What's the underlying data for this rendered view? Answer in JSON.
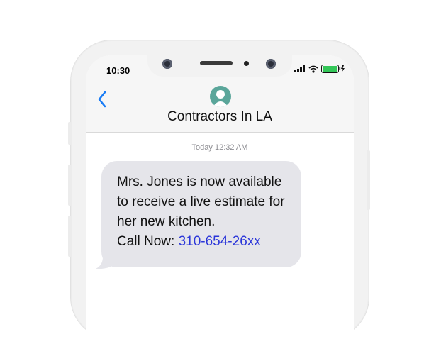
{
  "status_bar": {
    "time": "10:30"
  },
  "conversation": {
    "contact_name": "Contractors In LA",
    "timestamp": "Today 12:32 AM"
  },
  "message": {
    "lines": [
      "Mrs. Jones is now available",
      "to receive a live estimate for",
      "her new kitchen."
    ],
    "call_prefix": "Call Now: ",
    "phone_number": "310-654-26xx"
  },
  "colors": {
    "accent": "#1a7cf5",
    "bubble": "#e5e5ea",
    "link": "#2b36d9",
    "avatar": "#5aa69a",
    "battery": "#34c759"
  },
  "icons": {
    "back": "chevron-left-icon",
    "signal": "signal-icon",
    "wifi": "wifi-icon",
    "battery": "battery-icon"
  }
}
